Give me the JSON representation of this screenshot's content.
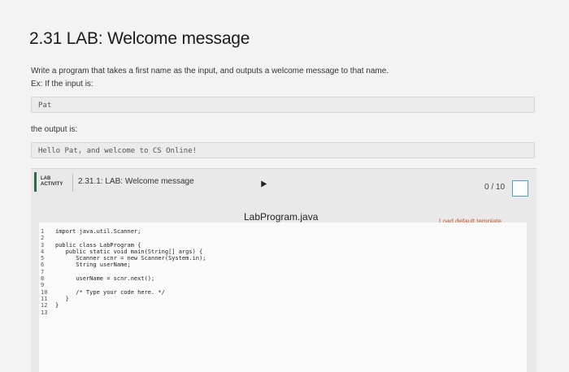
{
  "title": "2.31 LAB: Welcome message",
  "instructions": {
    "line1": "Write a program that takes a first name as the input, and outputs a welcome message to that name.",
    "line2": "Ex: If the input is:",
    "input_example": "Pat",
    "line3": "the output is:",
    "output_example": "Hello Pat, and welcome to CS Online!"
  },
  "lab": {
    "badge_line1": "LAB",
    "badge_line2": "ACTIVITY",
    "name": "2.31.1: LAB: Welcome message",
    "score": "0 / 10",
    "file_name": "LabProgram.java",
    "load_template": "Load default template..."
  },
  "editor": {
    "line_numbers": [
      "1",
      "2",
      "3",
      "4",
      "5",
      "6",
      "7",
      "8",
      "9",
      "10",
      "11",
      "12",
      "13"
    ],
    "lines": [
      "import java.util.Scanner;",
      "",
      "public class LabProgram {",
      "   public static void main(String[] args) {",
      "      Scanner scnr = new Scanner(System.in);",
      "      String userName;",
      "",
      "      userName = scnr.next();",
      "",
      "      /* Type your code here. */",
      "   }",
      "}",
      ""
    ]
  }
}
